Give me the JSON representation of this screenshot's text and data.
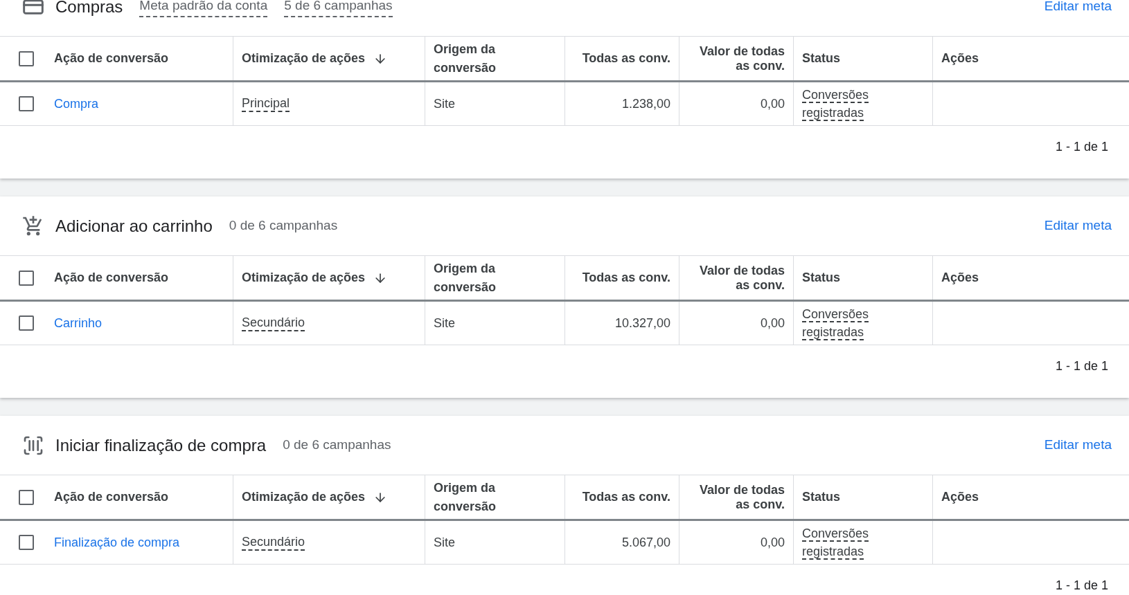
{
  "sections": [
    {
      "kind": "card",
      "title": "Compras",
      "tags": [
        {
          "text": "Meta padrão da conta",
          "underlined": true
        },
        {
          "text": "5 de 6 campanhas",
          "underlined": true
        }
      ],
      "edit_link": "Editar meta",
      "columns": [
        "Ação de conversão",
        "Otimização de ações",
        "Origem da conversão",
        "Todas as conv.",
        "Valor de todas as conv.",
        "Status",
        "Ações"
      ],
      "header_checked": false,
      "rows": [
        {
          "checked": false,
          "action": "Compra",
          "optimization": "Principal",
          "source": "Site",
          "all_conv": "1.238,00",
          "value": "0,00",
          "status": "Conversões registradas"
        }
      ],
      "pagination": "1 - 1 de 1"
    },
    {
      "kind": "cart",
      "title": "Adicionar ao carrinho",
      "tags": [
        {
          "text": "0 de 6 campanhas",
          "underlined": false
        }
      ],
      "edit_link": "Editar meta",
      "columns": [
        "Ação de conversão",
        "Otimização de ações",
        "Origem da conversão",
        "Todas as conv.",
        "Valor de todas as conv.",
        "Status",
        "Ações"
      ],
      "header_checked": false,
      "rows": [
        {
          "checked": false,
          "action": "Carrinho",
          "optimization": "Secundário",
          "source": "Site",
          "all_conv": "10.327,00",
          "value": "0,00",
          "status": "Conversões registradas"
        }
      ],
      "pagination": "1 - 1 de 1"
    },
    {
      "kind": "barcode",
      "title": "Iniciar finalização de compra",
      "tags": [
        {
          "text": "0 de 6 campanhas",
          "underlined": false
        }
      ],
      "edit_link": "Editar meta",
      "columns": [
        "Ação de conversão",
        "Otimização de ações",
        "Origem da conversão",
        "Todas as conv.",
        "Valor de todas as conv.",
        "Status",
        "Ações"
      ],
      "header_checked": false,
      "rows": [
        {
          "checked": false,
          "action": "Finalização de compra",
          "optimization": "Secundário",
          "source": "Site",
          "all_conv": "5.067,00",
          "value": "0,00",
          "status": "Conversões registradas"
        }
      ],
      "pagination": "1 - 1 de 1"
    }
  ]
}
